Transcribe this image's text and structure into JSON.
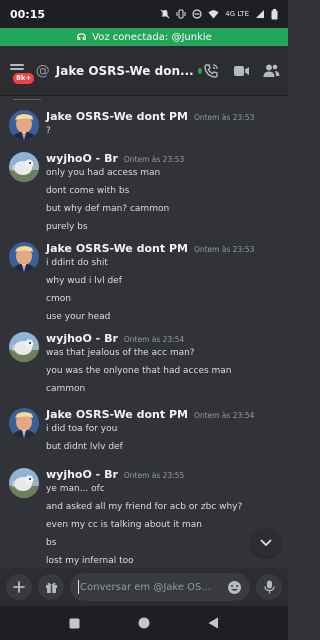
{
  "status_bar": {
    "time": "00:15",
    "network": "4G LTE"
  },
  "voice_bar": {
    "text": "Voz conectada: @Junkie"
  },
  "header": {
    "badge": "8k+",
    "channel": "Jake OSRS-We don...",
    "status_color": "#23a55a"
  },
  "messages": [
    {
      "author": "Jake OSRS-We dont PM",
      "timestamp": "Ontem às 23:53",
      "avatar": "jake-avatar",
      "lines": [
        "?"
      ]
    },
    {
      "author": "wyjhoO - Br",
      "timestamp": "Ontem às 23:53",
      "avatar": "wyjhoo-avatar",
      "lines": [
        "only you had access man",
        "dont come with bs",
        "but why def man? cammon",
        "purely bs"
      ]
    },
    {
      "author": "Jake OSRS-We dont PM",
      "timestamp": "Ontem às 23:53",
      "avatar": "jake-avatar",
      "lines": [
        "i ddint do shit",
        "why wud i lvl def",
        "cmon",
        "use your head"
      ]
    },
    {
      "author": "wyjhoO - Br",
      "timestamp": "Ontem às 23:54",
      "avatar": "wyjhoo-avatar",
      "lines": [
        "was that jealous of the acc man?",
        "you was the onlyone that had acces man",
        "cammon"
      ]
    },
    {
      "author": "Jake OSRS-We dont PM",
      "timestamp": "Ontem às 23:54",
      "avatar": "jake-avatar",
      "lines": [
        "i did toa for you",
        "but didnt lvlv def"
      ]
    },
    {
      "author": "wyjhoO - Br",
      "timestamp": "Ontem às 23:55",
      "avatar": "wyjhoo-avatar",
      "lines": [
        "ye man... ofc",
        "and asked all my friend for acb or zbc why?",
        "even my cc is talking about it man",
        "bs",
        "lost my infernal too"
      ]
    }
  ],
  "composer": {
    "placeholder": "Conversar em @Jake OS..."
  },
  "colors": {
    "background": "#313338",
    "header": "#2b2d31",
    "voice": "#23a55a",
    "badge": "#f23f43"
  }
}
